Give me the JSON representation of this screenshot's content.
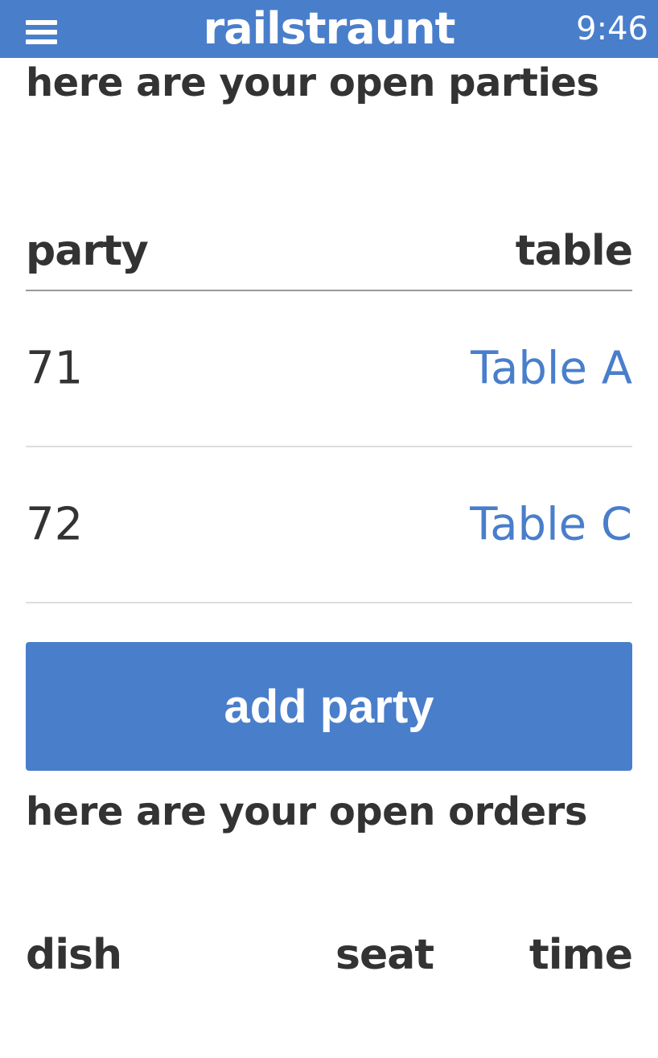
{
  "header": {
    "title": "railstraunt",
    "time": "9:46",
    "menu_icon": "hamburger-menu-icon"
  },
  "parties": {
    "title": "here are your open parties",
    "columns": {
      "party": "party",
      "table": "table"
    },
    "rows": [
      {
        "party": "71",
        "table": "Table A"
      },
      {
        "party": "72",
        "table": "Table C"
      }
    ],
    "add_button": "add party"
  },
  "orders": {
    "title": "here are your open orders",
    "columns": {
      "dish": "dish",
      "seat": "seat",
      "time": "time"
    }
  },
  "colors": {
    "accent": "#497ecb",
    "text": "#333333",
    "background": "#ffffff"
  }
}
